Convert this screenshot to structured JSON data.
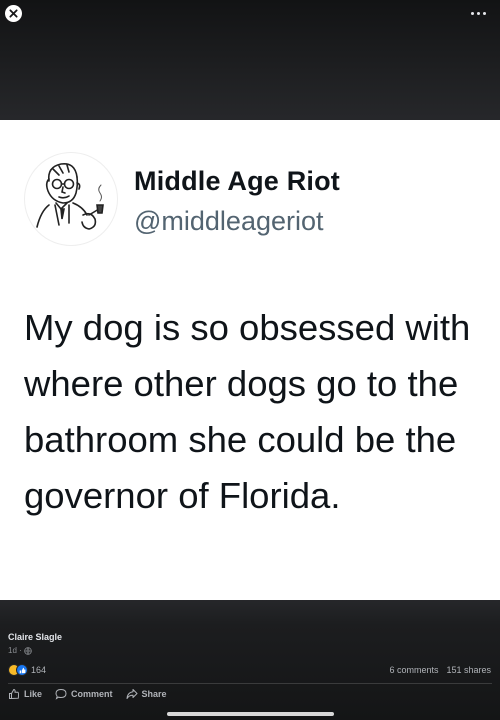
{
  "top_bar": {
    "close_icon": "close-icon",
    "more_icon": "more-horizontal-icon"
  },
  "tweet": {
    "avatar": "vintage-man-with-pipe-illustration",
    "display_name": "Middle Age Riot",
    "handle": "@middleageriot",
    "text": "My dog is so obsessed with where other dogs go to the bathroom she could be the governor of Florida."
  },
  "post": {
    "author": "Claire Slagle",
    "time": "1d ·",
    "privacy_icon": "globe-icon",
    "reaction_count": "164",
    "reactions": [
      "haha",
      "like"
    ],
    "comments": "6 comments",
    "shares": "151 shares"
  },
  "actions": {
    "like": "Like",
    "comment": "Comment",
    "share": "Share"
  },
  "colors": {
    "background": "#18191a",
    "tweet_card": "#ffffff",
    "like_blue": "#1877f2",
    "haha_yellow": "#f7b928"
  }
}
